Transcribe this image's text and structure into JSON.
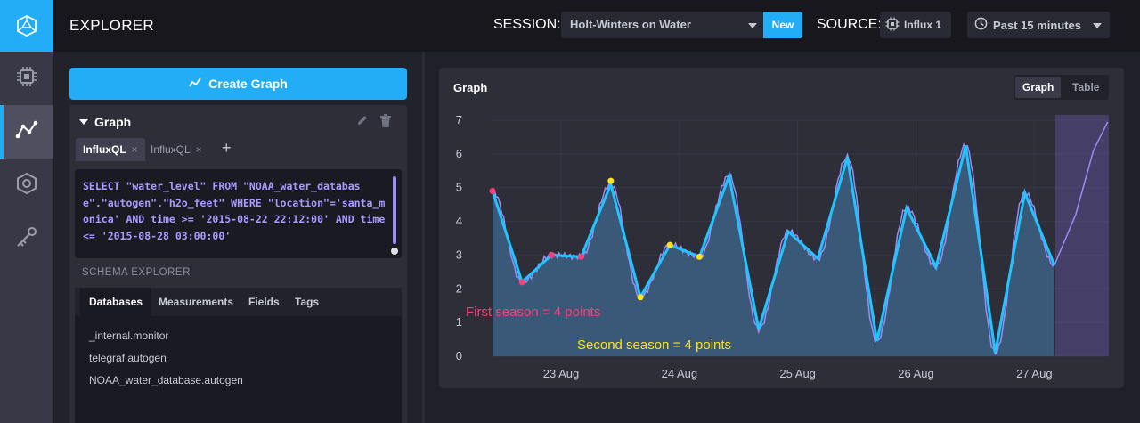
{
  "nav": {
    "items": [
      {
        "name": "logo",
        "icon": "influx-logo-icon"
      },
      {
        "name": "hosts",
        "icon": "chip-icon"
      },
      {
        "name": "data-explorer",
        "icon": "graph-icon",
        "active": true
      },
      {
        "name": "alerts",
        "icon": "hexagon-alert-icon"
      },
      {
        "name": "admin",
        "icon": "key-icon"
      }
    ]
  },
  "header": {
    "title": "EXPLORER",
    "session_label": "SESSION:",
    "session_value": "Holt-Winters on Water",
    "new_label": "New",
    "source_label": "SOURCE:",
    "source_value": "Influx 1",
    "time_range": "Past 15 minutes"
  },
  "left": {
    "create_label": "Create Graph",
    "query_title": "Graph",
    "tabs": [
      {
        "label": "InfluxQL",
        "active": true
      },
      {
        "label": "InfluxQL",
        "active": false
      }
    ],
    "add_tab": "+",
    "query_text": "SELECT \"water_level\" FROM \"NOAA_water_database\".\"autogen\".\"h2o_feet\" WHERE \"location\"='santa_monica' AND time >= '2015-08-22 22:12:00' AND time <= '2015-08-28 03:00:00'",
    "schema_title": "SCHEMA EXPLORER",
    "schema_tabs": [
      "Databases",
      "Measurements",
      "Fields",
      "Tags"
    ],
    "databases": [
      "_internal.monitor",
      "telegraf.autogen",
      "NOAA_water_database.autogen"
    ]
  },
  "graph": {
    "title": "Graph",
    "view_graph": "Graph",
    "view_table": "Table"
  },
  "chart_data": {
    "type": "line",
    "title": "",
    "xlabel": "",
    "ylabel": "",
    "ylim": [
      0,
      7
    ],
    "xlim": [
      22.92,
      28.13
    ],
    "x_tick_labels": [
      "23 Aug",
      "24 Aug",
      "25 Aug",
      "26 Aug",
      "27 Aug"
    ],
    "x_ticks": [
      23.5,
      24.5,
      25.5,
      26.5,
      27.5
    ],
    "y_ticks": [
      0,
      1,
      2,
      3,
      4,
      5,
      6,
      7
    ],
    "colors": {
      "raw": "#9b8cf5",
      "fit": "#22c4ff",
      "area": "#3c5f82",
      "first": "#ff3d77",
      "second": "#ffe21a",
      "forecast": "#5a4f8f"
    },
    "series": [
      {
        "values": [
          [
            22.92,
            4.9
          ],
          [
            23.17,
            2.2
          ],
          [
            23.42,
            3.0
          ],
          [
            23.67,
            2.95
          ],
          [
            23.92,
            5.1
          ],
          [
            24.17,
            1.75
          ],
          [
            24.42,
            3.3
          ],
          [
            24.67,
            2.95
          ],
          [
            24.92,
            5.35
          ],
          [
            25.17,
            0.8
          ],
          [
            25.42,
            3.7
          ],
          [
            25.67,
            2.9
          ],
          [
            25.92,
            5.9
          ],
          [
            26.17,
            0.45
          ],
          [
            26.42,
            4.4
          ],
          [
            26.67,
            2.65
          ],
          [
            26.92,
            6.25
          ],
          [
            27.17,
            0.1
          ],
          [
            27.42,
            4.85
          ],
          [
            27.67,
            2.7
          ]
        ]
      }
    ],
    "first_season": {
      "label": "First season = 4 points",
      "points": [
        [
          22.92,
          4.9
        ],
        [
          23.17,
          2.2
        ],
        [
          23.42,
          3.0
        ],
        [
          23.67,
          2.95
        ]
      ]
    },
    "second_season": {
      "label": "Second season = 4 points",
      "points": [
        [
          23.92,
          5.2
        ],
        [
          24.17,
          1.75
        ],
        [
          24.42,
          3.3
        ],
        [
          24.67,
          2.95
        ]
      ]
    },
    "forecast_start": 27.67
  }
}
